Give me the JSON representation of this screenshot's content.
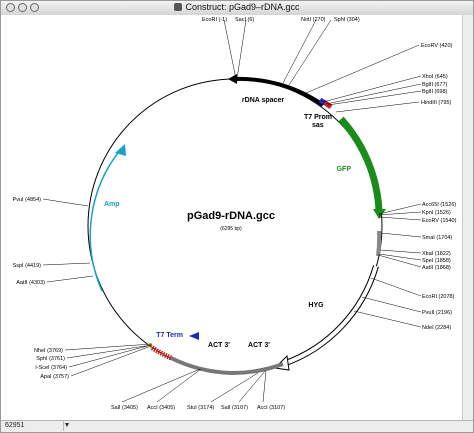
{
  "window": {
    "title": "Construct:  pGad9–rDNA.gcc"
  },
  "status": {
    "position": "62951",
    "arrow": "▼"
  },
  "map": {
    "name": "pGad9-rDNA.gcc",
    "size": "(6295 bp)",
    "features": {
      "rdna_spacer": "rDNA spacer",
      "t7_prom": "T7 Prom",
      "sas": "sas",
      "gfp": "GFP",
      "hyg": "HYG",
      "amp": "Amp",
      "t7_term": "T7 Term",
      "act_a": "ACT 3'",
      "act_b": "ACT 3'"
    },
    "sites": {
      "ecori_1": "EcoRI (-1)",
      "saci": "SacI (6)",
      "noti": "NotI (270)",
      "sphi_304": "SphI (304)",
      "ecorv_420": "EcoRV (420)",
      "xhoi": "XhoI (645)",
      "bglii_677": "BglII (677)",
      "bglii_698": "BglII (698)",
      "hindiii": "HindIII (795)",
      "acc65i": "Acc65I (1526)",
      "kpni": "KpnI (1526)",
      "ecorv_1540": "EcoRV (1540)",
      "smai": "SmaI (1704)",
      "xbai": "XbaI (1822)",
      "spei": "SpeI (1858)",
      "aatii": "AatII (1868)",
      "ecori_2078": "EcoRI (2078)",
      "pvuii": "PvuII (2196)",
      "ndei": "NdeI (2284)",
      "acci_3107": "AccI (3107)",
      "sali_3107": "SalI (3107)",
      "stui": "StuI (3174)",
      "acci_3405": "AccI (3405)",
      "sali_3405": "SalI (3405)",
      "apai": "ApaI (3757)",
      "iscei": "I-SceI (3764)",
      "sphi_3761": "SphI (3761)",
      "nhei": "NheI (3769)",
      "aatii_4303": "AatII (4303)",
      "sspi": "SspI (4419)",
      "pvui": "PvuI (4854)"
    },
    "colors": {
      "backbone": "#000000",
      "gfp": "#1a8c1a",
      "amp": "#1aa0c8",
      "t7_term": "#1a2ab8",
      "hyg": "#ffffff",
      "red_marker": "#cc2020"
    }
  }
}
